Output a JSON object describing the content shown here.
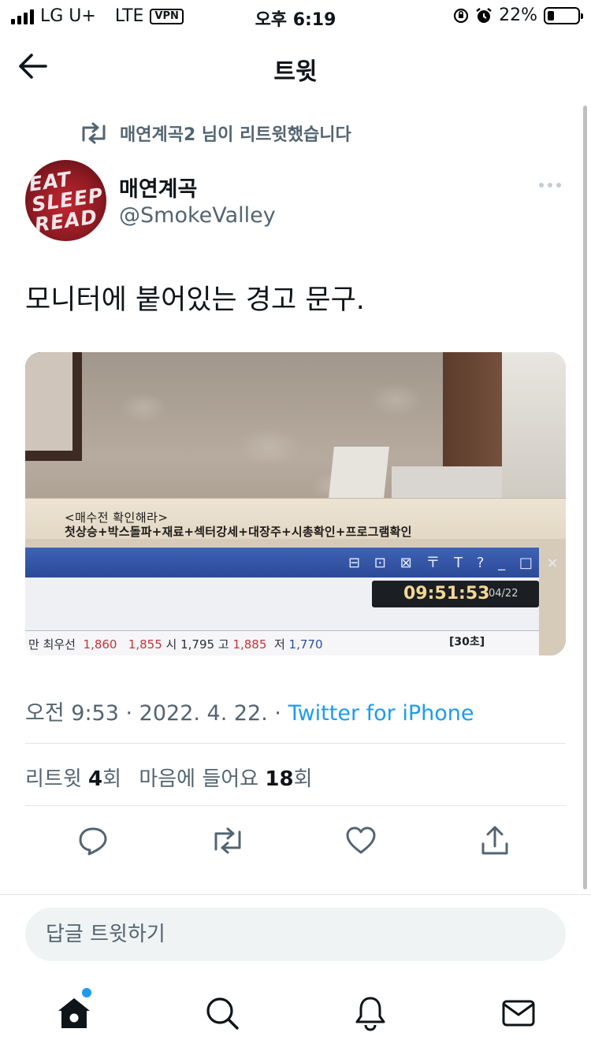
{
  "status_bar": {
    "carrier": "LG U+",
    "network": "LTE",
    "vpn": "VPN",
    "time": "오후 6:19",
    "battery": "22%",
    "battery_level": 0.22
  },
  "header": {
    "title": "트윗"
  },
  "retweet_context": {
    "text": "매연계곡2 님이 리트윗했습니다"
  },
  "author": {
    "name": "매연계곡",
    "handle": "@SmokeValley",
    "avatar_text": "EAT SLEEP READ"
  },
  "tweet": {
    "text": "모니터에 붙어있는 경고 문구."
  },
  "media": {
    "tape_line1": "<매수전 확인해라>",
    "tape_line2": "첫상승+박스돌파+재료+섹터강세+대장주+시총확인+프로그램확인",
    "screen_icons": "⊟ ⊡ ⊠ 〒 T ? _ □ ×",
    "clock_time": "09:51:53",
    "clock_date": "04/22",
    "quote_label": "최우선",
    "quote_v1": "1,860",
    "quote_v2": "1,855",
    "quote_open_label": "시",
    "quote_open": "1,795",
    "quote_high_label": "고",
    "quote_high": "1,885",
    "quote_low_label": "저",
    "quote_low": "1,770",
    "quote_btn": "[30초]"
  },
  "meta": {
    "time": "오전 9:53",
    "separator": " · ",
    "date": "2022. 4. 22.",
    "source": "Twitter for iPhone"
  },
  "stats": {
    "retweets_label": "리트윗",
    "retweets_count": "4",
    "retweets_unit": "회",
    "likes_label": "마음에 들어요",
    "likes_count": "18",
    "likes_unit": "회"
  },
  "reply": {
    "placeholder": "답글 트윗하기"
  },
  "icons": {
    "back": "arrow-left-icon",
    "retweet": "retweet-icon",
    "more": "more-dots-icon",
    "reply": "reply-icon",
    "like": "heart-icon",
    "share": "share-icon",
    "home": "home-icon",
    "search": "search-icon",
    "notifications": "bell-icon",
    "messages": "mail-icon"
  },
  "colors": {
    "accent": "#1d9bf0",
    "text_secondary": "#536471"
  }
}
